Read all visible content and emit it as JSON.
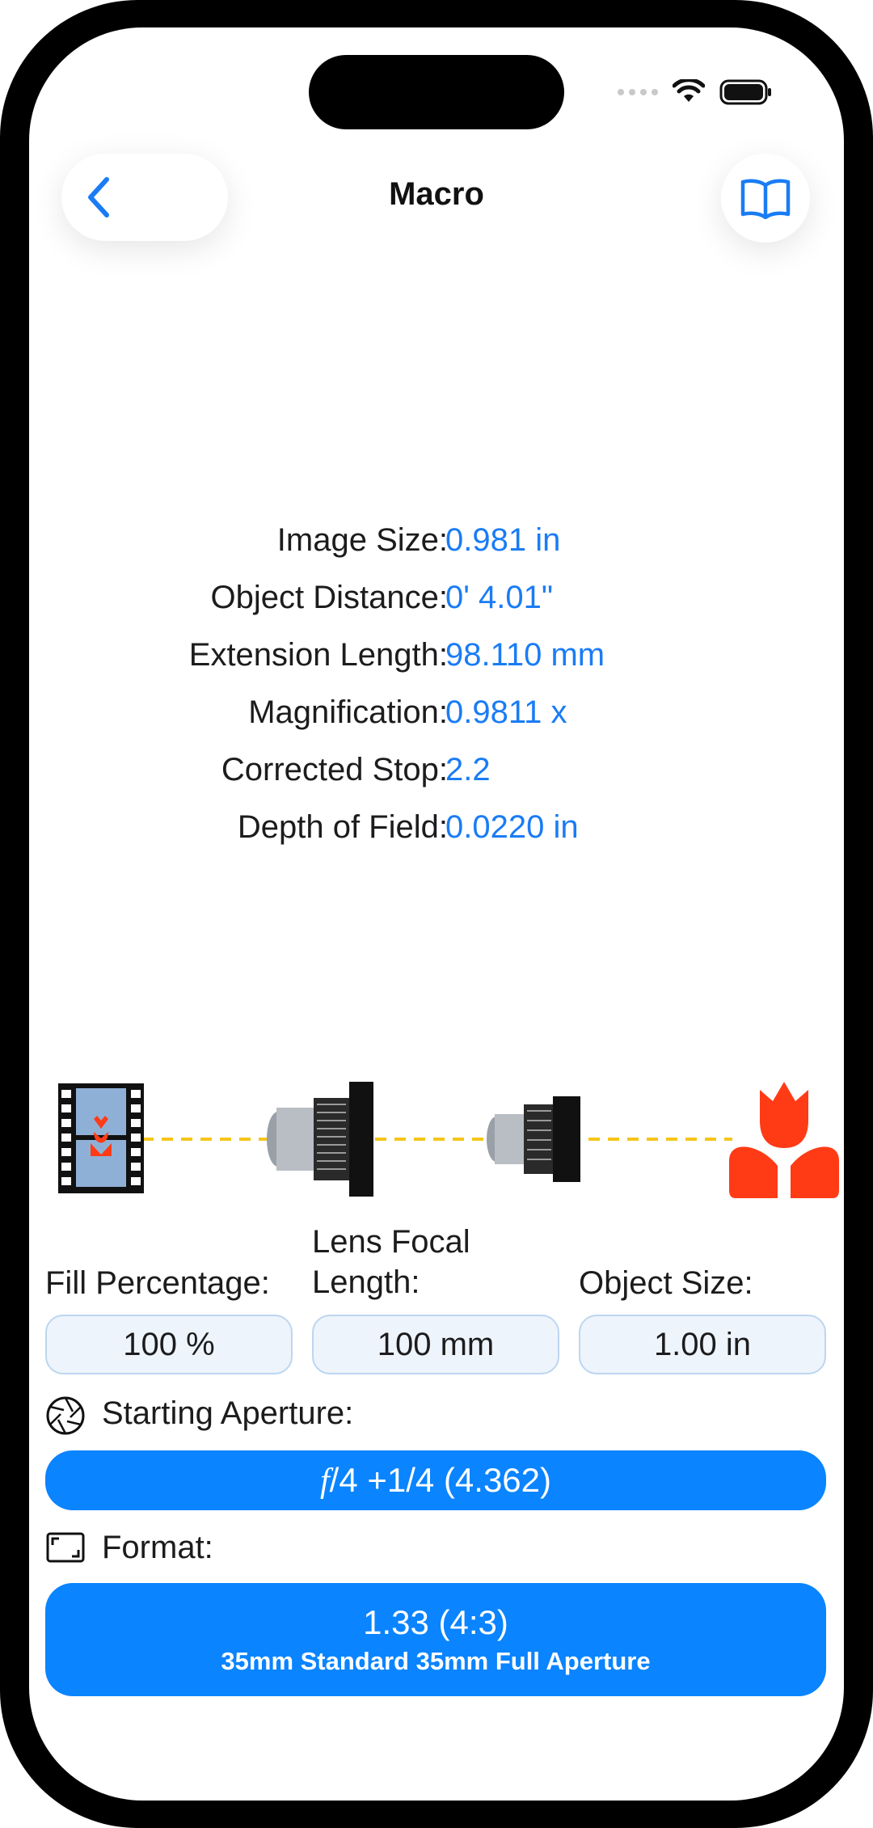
{
  "nav": {
    "title": "Macro"
  },
  "results": [
    {
      "label": "Image Size:",
      "value": "0.981 in"
    },
    {
      "label": "Object Distance:",
      "value": "0' 4.01\""
    },
    {
      "label": "Extension Length:",
      "value": "98.110 mm"
    },
    {
      "label": "Magnification:",
      "value": "0.9811 x"
    },
    {
      "label": "Corrected Stop:",
      "value": "2.2"
    },
    {
      "label": "Depth of Field:",
      "value": "0.0220 in"
    }
  ],
  "inputs": {
    "fill_percentage": {
      "label": "Fill Percentage:",
      "value": "100 %"
    },
    "lens_focal_length": {
      "label_line1": "Lens Focal",
      "label_line2": "Length:",
      "value": "100 mm"
    },
    "object_size": {
      "label": "Object Size:",
      "value": "1.00 in"
    }
  },
  "aperture": {
    "label": "Starting Aperture:",
    "f_symbol": "f",
    "value": "/4 +1/4 (4.362)"
  },
  "format": {
    "label": "Format:",
    "main": "1.33 (4:3)",
    "sub": "35mm Standard 35mm Full Aperture"
  },
  "icons": {
    "back": "chevron-left-icon",
    "book": "book-icon",
    "film": "film-frame-icon",
    "lens": "cine-lens-icon",
    "object": "tulip-macro-icon",
    "aperture": "aperture-icon",
    "format": "frame-corners-icon"
  },
  "colors": {
    "accent": "#0a84ff",
    "value_text": "#1a7cf5",
    "tulip": "#ff3b16",
    "axis_line": "#f5c518",
    "input_bg": "#eef4fb"
  }
}
